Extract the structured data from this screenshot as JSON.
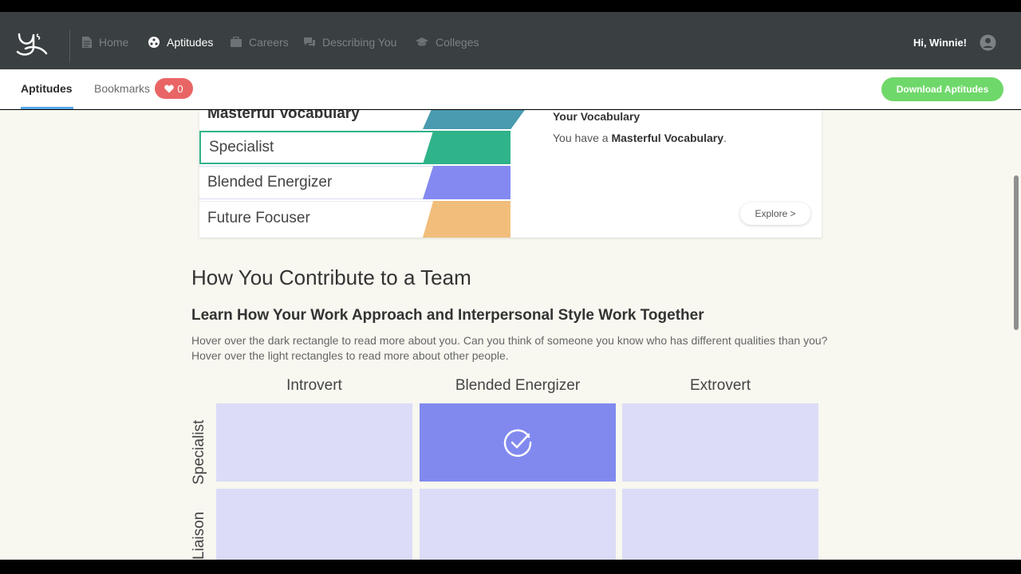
{
  "nav": {
    "items": [
      {
        "label": "Home",
        "icon": "document-icon"
      },
      {
        "label": "Aptitudes",
        "icon": "aptitude-icon"
      },
      {
        "label": "Careers",
        "icon": "briefcase-icon"
      },
      {
        "label": "Describing You",
        "icon": "chat-icon"
      },
      {
        "label": "Colleges",
        "icon": "graduation-cap-icon"
      }
    ],
    "greeting": "Hi, Winnie!"
  },
  "subnav": {
    "tabs": [
      "Aptitudes",
      "Bookmarks"
    ],
    "bookmark_count": "0",
    "download_label": "Download Aptitudes"
  },
  "aptitudes": {
    "rows": [
      {
        "label": "Masterful Vocabulary",
        "color": "#4a9bb0"
      },
      {
        "label": "Specialist",
        "color": "#2fb38a"
      },
      {
        "label": "Blended Energizer",
        "color": "#8389f0"
      },
      {
        "label": "Future Focuser",
        "color": "#f1bd7b"
      }
    ],
    "info_title": "Your Vocabulary",
    "info_prefix": "You have a ",
    "info_bold": "Masterful Vocabulary",
    "info_suffix": ".",
    "explore_label": "Explore >"
  },
  "team": {
    "title": "How You Contribute to a Team",
    "subtitle": "Learn How Your Work Approach and Interpersonal Style Work Together",
    "description": "Hover over the dark rectangle to read more about you. Can you think of someone you know who has different qualities than you? Hover over the light rectangles to read more about other people.",
    "columns": [
      "Introvert",
      "Blended Energizer",
      "Extrovert"
    ],
    "rows": [
      "Specialist",
      "Liaison"
    ],
    "selected": {
      "row": "Specialist",
      "column": "Blended Energizer"
    }
  }
}
